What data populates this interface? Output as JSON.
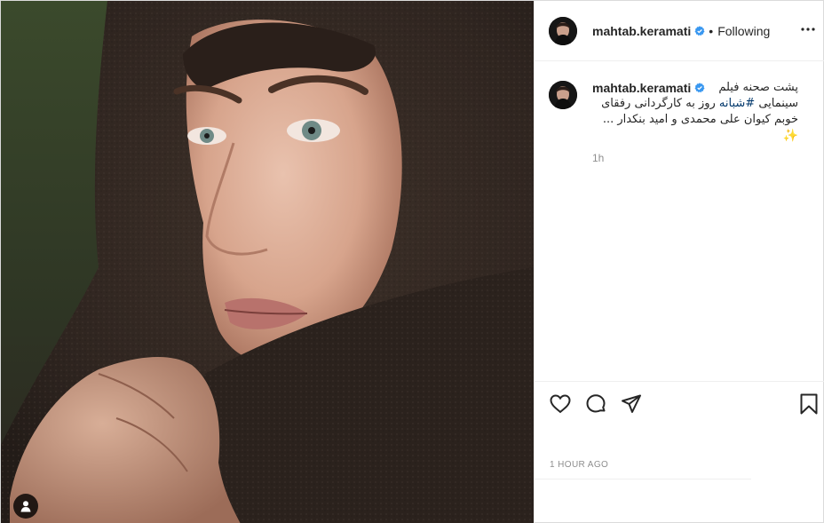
{
  "post": {
    "username": "mahtab.keramati",
    "separator": "•",
    "follow_status": "Following",
    "caption": {
      "line1": "پشت صحنه فیلم",
      "line2_prefix": "سینمایی ",
      "hashtag": "#شبانه",
      "line2_suffix": " روز به کارگردانی رفقای",
      "line3": "خوبم کیوان علی محمدی و امید بنکدار ...",
      "emoji": "✨"
    },
    "comment_age": "1h",
    "timestamp": "1 HOUR AGO"
  },
  "icons": {
    "more": "more-options-icon",
    "verified": "verified-badge-icon",
    "like": "heart-icon",
    "comment": "comment-bubble-icon",
    "share": "paper-plane-icon",
    "save": "bookmark-icon",
    "tag": "user-tag-icon"
  },
  "colors": {
    "verified": "#3897f0",
    "hashtag": "#00376b",
    "secondary_text": "#8e8e8e",
    "divider": "#efefef"
  }
}
